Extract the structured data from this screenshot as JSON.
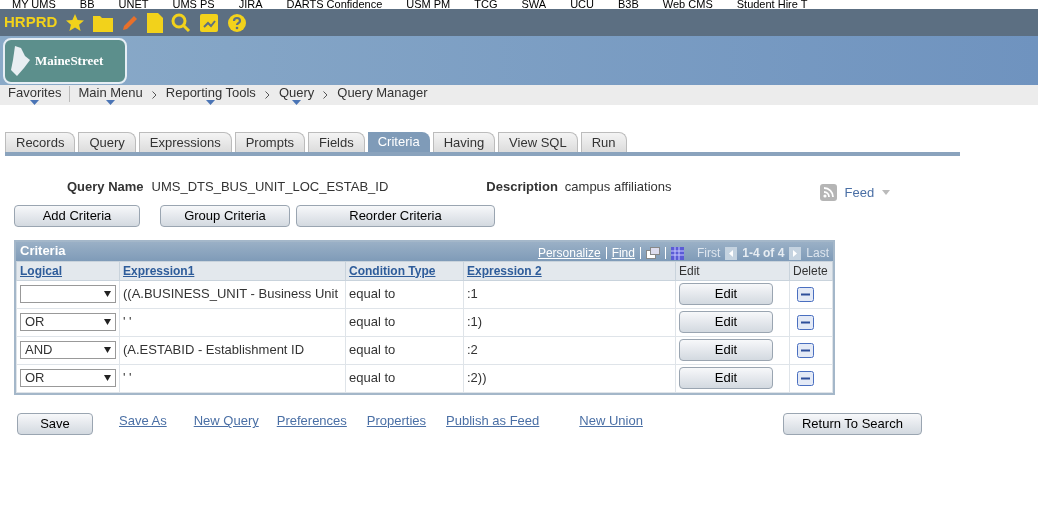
{
  "bookmarks": [
    "MY UMS",
    "BB",
    "UNET",
    "UMS PS",
    "JIRA",
    "DARTS Confidence",
    "USM PM",
    "TCG",
    "SWA",
    "UCU",
    "B3B",
    "Web CMS",
    "Student Hire T"
  ],
  "environment": "HRPRD",
  "logo": "MaineStreet",
  "breadcrumb": [
    {
      "label": "Favorites",
      "menu": true
    },
    {
      "label": "Main Menu",
      "menu": true
    },
    {
      "label": "Reporting Tools",
      "menu": true
    },
    {
      "label": "Query",
      "menu": true
    },
    {
      "label": "Query Manager",
      "menu": false
    }
  ],
  "tabs": [
    {
      "label": "Records",
      "selected": false
    },
    {
      "label": "Query",
      "selected": false
    },
    {
      "label": "Expressions",
      "selected": false
    },
    {
      "label": "Prompts",
      "selected": false
    },
    {
      "label": "Fields",
      "selected": false
    },
    {
      "label": "Criteria",
      "selected": true
    },
    {
      "label": "Having",
      "selected": false
    },
    {
      "label": "View SQL",
      "selected": false
    },
    {
      "label": "Run",
      "selected": false
    }
  ],
  "query_name": {
    "label": "Query Name",
    "value": "UMS_DTS_BUS_UNIT_LOC_ESTAB_ID"
  },
  "description": {
    "label": "Description",
    "value": "campus affiliations"
  },
  "feed": "Feed",
  "actions": [
    "Add Criteria",
    "Group Criteria",
    "Reorder Criteria"
  ],
  "grid": {
    "title": "Criteria",
    "personalize": "Personalize",
    "find": "Find",
    "first": "First",
    "count": "1-4 of 4",
    "last": "Last",
    "columns": [
      "Logical",
      "Expression1",
      "Condition Type",
      "Expression 2",
      "Edit",
      "Delete"
    ],
    "rows": [
      {
        "logical": "",
        "expression1": "((A.BUSINESS_UNIT - Business Unit",
        "condition": "equal to",
        "expression2": ":1",
        "edit": "Edit"
      },
      {
        "logical": "OR",
        "expression1": "' '",
        "condition": "equal to",
        "expression2": ":1)",
        "edit": "Edit"
      },
      {
        "logical": "AND",
        "expression1": "(A.ESTABID - Establishment ID",
        "condition": "equal to",
        "expression2": ":2",
        "edit": "Edit"
      },
      {
        "logical": "OR",
        "expression1": "' '",
        "condition": "equal to",
        "expression2": ":2))",
        "edit": "Edit"
      }
    ]
  },
  "save": "Save",
  "links": [
    "Save As",
    "New Query",
    "Preferences",
    "Properties",
    "Publish as Feed",
    "New Union"
  ],
  "return": "Return To Search"
}
